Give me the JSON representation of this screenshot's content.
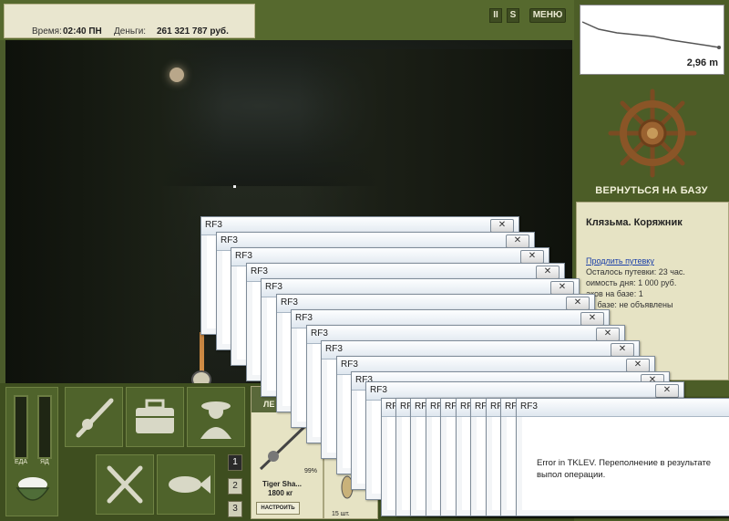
{
  "status": {
    "time_label": "Время:",
    "time_value": "02:40 ПН",
    "money_label": "Деньги:",
    "money_value": "261 321 787 руб."
  },
  "top_buttons": {
    "pause": "II",
    "s": "S",
    "menu": "МЕНЮ"
  },
  "depth": {
    "value": "2,96 m"
  },
  "right": {
    "return_label": "ВЕРНУТЬСЯ НА БАЗУ"
  },
  "info": {
    "location": "Клязьма. Коряжник",
    "extend_link": "Продлить путевку",
    "lines": [
      "Осталось путевки: 23 час.",
      "оимость дня: 1 000 руб.",
      "аков на базе: 1",
      "на базе: не объявлены"
    ]
  },
  "meters": {
    "food_label": "ЕДА",
    "poison_label": "ЯД"
  },
  "pages": [
    "1",
    "2",
    "3"
  ],
  "tackle": {
    "header": "ЛЕ",
    "name": "Tiger Sha...",
    "weight": "1800 кг",
    "condition": "99%",
    "setup_label": "НАСТРОИТЬ"
  },
  "bait": {
    "count": "15 шт."
  },
  "dialog": {
    "title": "RF3",
    "close_glyph": "✕",
    "message": "Error in TKLEV. Переполнение в результате выпол операции."
  }
}
